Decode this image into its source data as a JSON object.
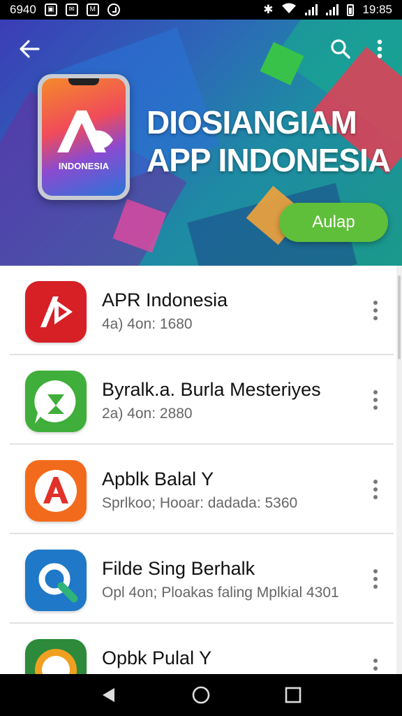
{
  "status_bar": {
    "left_text": "6940",
    "time": "19:85",
    "icons": [
      "image-icon",
      "mail-icon",
      "gmail-icon",
      "alarm-icon",
      "bluetooth-icon",
      "wifi-icon",
      "signal-icon",
      "signal-icon",
      "battery-icon"
    ]
  },
  "banner": {
    "title_line1": "DIOSIANGIAM",
    "title_line2": "APP INDONESIA",
    "phone_label": "INDONESIA",
    "cta_label": "Aulap",
    "icons": [
      "back-arrow-icon",
      "search-icon",
      "more-vertical-icon"
    ]
  },
  "apps": [
    {
      "name": "APR Indonesia",
      "meta": "4a) 4on: 1680",
      "icon": "play-logo-icon",
      "color": "#d71f26"
    },
    {
      "name": "Byralk.a. Burla Mesteriyes",
      "meta": "2a) 4on: 2880",
      "icon": "chat-bubble-icon",
      "color": "#3fae3a"
    },
    {
      "name": "Apblk Balal Y",
      "meta": "Sprlkoo; Hooar: dadada: 5360",
      "icon": "a-logo-icon",
      "color": "#f26b1d"
    },
    {
      "name": "Filde Sing Berhalk",
      "meta": "Opl 4on; Ploakas faling Mplkial 4301",
      "icon": "q-logo-icon",
      "color": "#1f78c8"
    },
    {
      "name": "Opbk Pulal Y",
      "meta": "",
      "icon": "compass-logo-icon",
      "color": "#2c8a3a"
    }
  ],
  "nav_bar": {
    "icons": [
      "back-triangle-icon",
      "home-circle-icon",
      "recents-square-icon"
    ]
  }
}
